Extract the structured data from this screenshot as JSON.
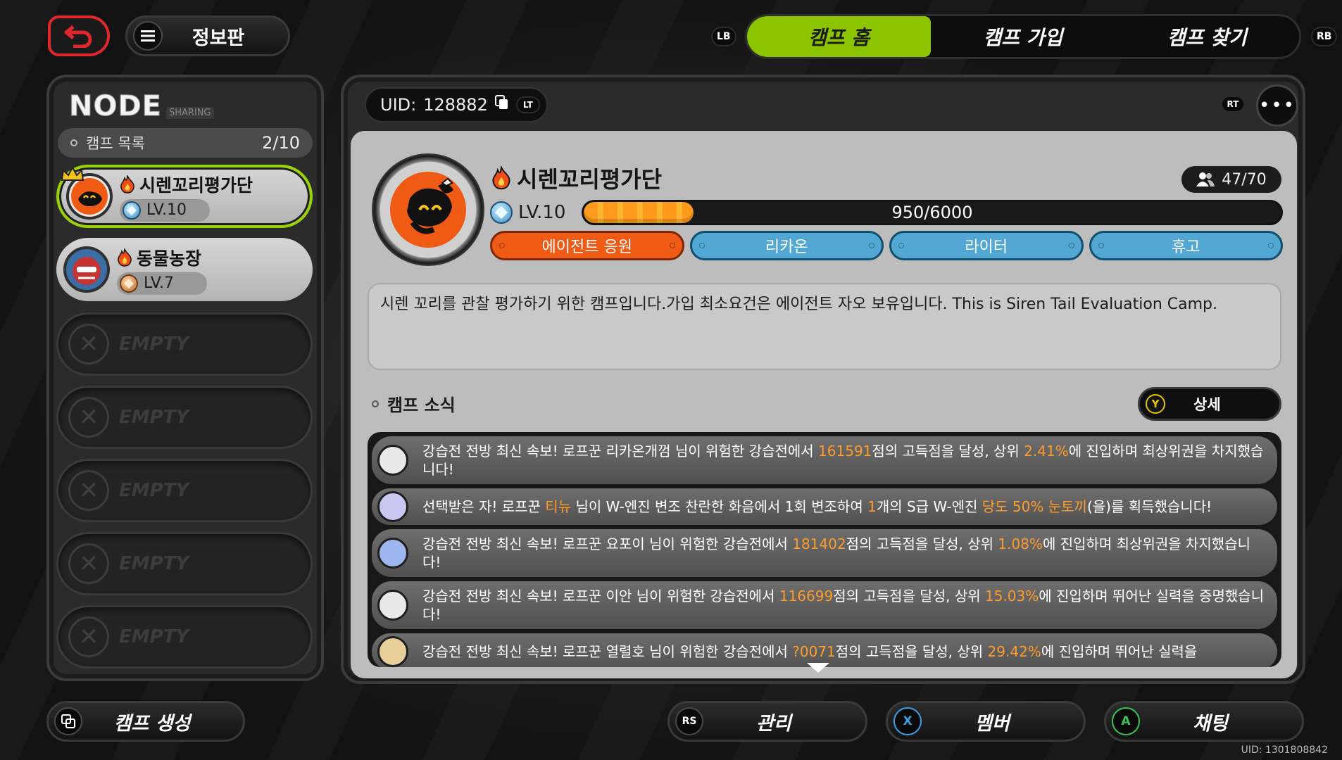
{
  "top": {
    "info_label": "정보판",
    "tabs": [
      {
        "label": "캠프 홈",
        "active": true
      },
      {
        "label": "캠프 가입",
        "active": false
      },
      {
        "label": "캠프 찾기",
        "active": false
      }
    ],
    "lb": "LB",
    "rb": "RB"
  },
  "left": {
    "logo": "NODE",
    "logo_sub": "SHARING",
    "list_title": "캠프 목록",
    "list_count": "2/10",
    "camps": [
      {
        "name": "시렌꼬리평가단",
        "level": "LV.10",
        "selected": true
      },
      {
        "name": "동물농장",
        "level": "LV.7",
        "selected": false
      }
    ],
    "empty_label": "EMPTY"
  },
  "main": {
    "uid_label": "UID:",
    "uid_value": "128882",
    "lt": "LT",
    "rt": "RT",
    "camp_name": "시렌꼬리평가단",
    "members": "47/70",
    "level": "LV.10",
    "xp_text": "950/6000",
    "xp_fraction": 0.158,
    "tags": [
      "에이전트 응원",
      "리카온",
      "라이터",
      "휴고"
    ],
    "description": "시렌 꼬리를 관찰 평가하기 위한 캠프입니다.가입 최소요건은 에이전트 자오 보유입니다. This is Siren Tail Evaluation Camp.",
    "news_title": "캠프 소식",
    "detail_key": "Y",
    "detail_label": "상세"
  },
  "news": [
    {
      "parts": [
        "강습전 전방 최신 속보! 로프꾼 리카온개껌 님이 위험한 강습전에서 ",
        "161591",
        "점의 고득점을 달성, 상위 ",
        "2.41%",
        "에 진입하며 최상위권을 차지했습니다!"
      ]
    },
    {
      "parts": [
        "선택받은 자! 로프꾼 ",
        "티뉴",
        " 님이 W-엔진 변조 찬란한 화음에서 1회 변조하여 ",
        "1",
        "개의 S급 W-엔진 ",
        "당도 50% 눈토끼",
        "(을)를 획득했습니다!"
      ]
    },
    {
      "parts": [
        "강습전 전방 최신 속보! 로프꾼 요포이 님이 위험한 강습전에서 ",
        "181402",
        "점의 고득점을 달성, 상위 ",
        "1.08%",
        "에 진입하며 최상위권을 차지했습니다!"
      ]
    },
    {
      "parts": [
        "강습전 전방 최신 속보! 로프꾼 이안 님이 위험한 강습전에서 ",
        "116699",
        "점의 고득점을 달성, 상위 ",
        "15.03%",
        "에 진입하며 뛰어난 실력을 증명했습니다!"
      ]
    },
    {
      "parts": [
        "강습전 전방 최신 속보! 로프꾼 열렬호 님이 위험한 강습전에서 ",
        "?0071",
        "점의 고득점을 달성, 상위 ",
        "29.42%",
        "에 진입하며 뛰어난 실력을"
      ]
    }
  ],
  "bottom": {
    "create_label": "캠프 생성",
    "manage_key": "RS",
    "manage_label": "관리",
    "member_key": "X",
    "member_label": "멤버",
    "chat_key": "A",
    "chat_label": "채팅",
    "footer_uid": "UID: 1301808842"
  },
  "colors": {
    "accent_green": "#8cc400",
    "highlight_orange": "#ff9b2a",
    "tag_orange": "#ef5a14",
    "tag_blue": "#52a8d2"
  }
}
